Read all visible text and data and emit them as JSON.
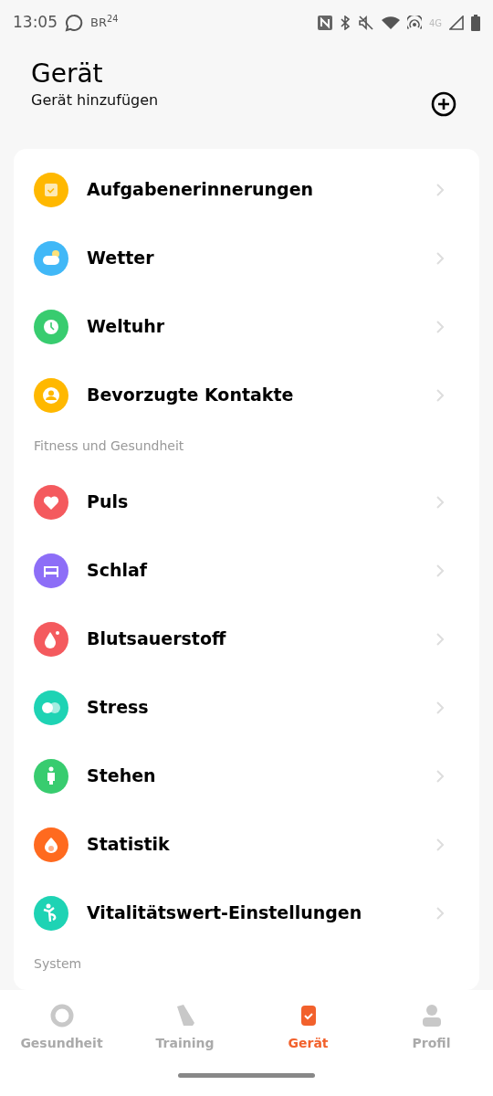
{
  "status_bar": {
    "time": "13:05",
    "logo": "BR$^{24}$",
    "network": "4G"
  },
  "header": {
    "title": "Gerät",
    "subtitle": "Gerät hinzufügen"
  },
  "sections": [
    {
      "items": [
        {
          "label": "Aufgabenerinnerungen",
          "color": "#ffb800"
        },
        {
          "label": "Wetter",
          "color": "#41b8f7"
        },
        {
          "label": "Weltuhr",
          "color": "#38cc6f"
        },
        {
          "label": "Bevorzugte Kontakte",
          "color": "#ffb800"
        }
      ]
    },
    {
      "label": "Fitness und Gesundheit",
      "items": [
        {
          "label": "Puls",
          "color": "#f45a5e"
        },
        {
          "label": "Schlaf",
          "color": "#8d6ef7"
        },
        {
          "label": "Blutsauerstoff",
          "color": "#f45a5e"
        },
        {
          "label": "Stress",
          "color": "#1ed3b4"
        },
        {
          "label": "Stehen",
          "color": "#38cc6f"
        },
        {
          "label": "Statistik",
          "color": "#ff6a1f"
        },
        {
          "label": "Vitalitätswert-Einstellungen",
          "color": "#1ed3b4"
        }
      ]
    },
    {
      "label": "System"
    }
  ],
  "tabs": [
    {
      "label": "Gesundheit",
      "selected": false
    },
    {
      "label": "Training",
      "selected": false
    },
    {
      "label": "Gerät",
      "selected": true
    },
    {
      "label": "Profil",
      "selected": false
    }
  ]
}
